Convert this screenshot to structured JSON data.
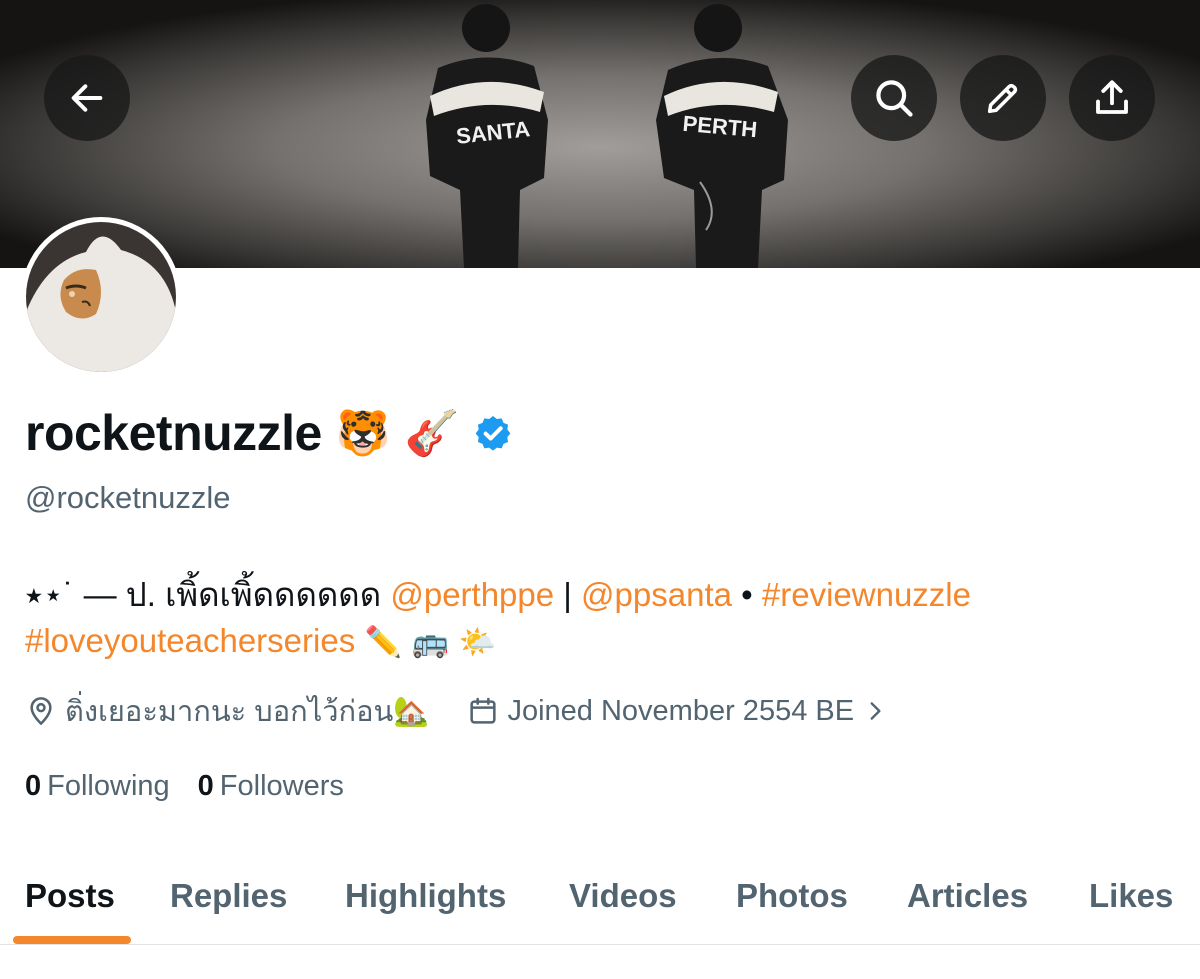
{
  "header": {
    "back_icon": "arrow-left-icon",
    "search_icon": "search-icon",
    "edit_icon": "pencil-icon",
    "share_icon": "share-upload-icon",
    "banner_jacket_left": "SANTA",
    "banner_jacket_right": "PERTH"
  },
  "profile": {
    "display_name": "rocketnuzzle",
    "name_emojis": "🐯 🎸",
    "verified_icon": "verified-badge-icon",
    "handle": "@rocketnuzzle",
    "bio": {
      "prefix": "⭑⋆˙ — ป. เพิ้ดเพิ้ดดดดดด ",
      "mention_1": "@perthppe",
      "separator_1": " | ",
      "mention_2": "@ppsanta",
      "separator_2": " • ",
      "hashtag_1": "#reviewnuzzle",
      "hashtag_2": "#loveyouteacherseries",
      "trailing_emojis": " ✏️ 🚌 🌤️"
    },
    "location": "ติ่งเยอะมากนะ บอกไว้ก่อน🏡",
    "joined": "Joined November 2554 BE",
    "following_count": "0",
    "following_label": "Following",
    "followers_count": "0",
    "followers_label": "Followers"
  },
  "tabs": [
    {
      "label": "Posts",
      "active": true
    },
    {
      "label": "Replies"
    },
    {
      "label": "Highlights"
    },
    {
      "label": "Videos"
    },
    {
      "label": "Photos"
    },
    {
      "label": "Articles"
    },
    {
      "label": "Likes"
    }
  ],
  "colors": {
    "accent": "#f4862b",
    "verified": "#1d9bf0",
    "secondary_text": "#536471",
    "primary_text": "#0f1419"
  }
}
